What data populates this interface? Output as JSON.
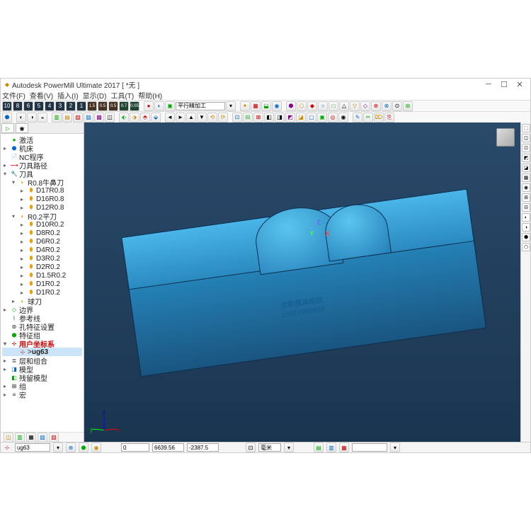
{
  "title": "Autodesk PowerMill Ultimate 2017   [ *无 ]",
  "menu": {
    "file": "文件(F)",
    "view": "查看(V)",
    "insert": "插入(I)",
    "display": "显示(D)",
    "tools": "工具(T)",
    "help": "帮助(H)"
  },
  "toolbar2_label": "平行精加工",
  "tree": {
    "root": {
      "active": "激活",
      "machine": "机床",
      "nc": "NC程序",
      "toolpath": "刀具路径",
      "tools": "刀具"
    },
    "g1": {
      "name": "R0.8牛鼻刀",
      "items": [
        "D17R0.8",
        "D16R0.8",
        "D12R0.8"
      ]
    },
    "g2": {
      "name": "R0.2平刀",
      "items": [
        "D10R0.2",
        "D8R0.2",
        "D6R0.2",
        "D4R0.2",
        "D3R0.2",
        "D2R0.2",
        "D1.5R0.2",
        "D1R0.2",
        "D1R0.2"
      ]
    },
    "g3": "球刀",
    "rest": {
      "boundary": "边界",
      "refline": "参考线",
      "featureset": "孔特征设置",
      "featuregrp": "特征组",
      "ucs": "用户坐标系",
      "ucs_item": "ug63",
      "layergrp": "层和组合",
      "model": "模型",
      "stock": "残留模型",
      "group": "组",
      "macro": "宏"
    }
  },
  "viewport": {
    "text1": "优职模具培训",
    "text2": "15557880808"
  },
  "status": {
    "coord_label": "ug63",
    "x": "0",
    "y": "6639.56",
    "z": "-2387.5",
    "unit": "毫米"
  }
}
